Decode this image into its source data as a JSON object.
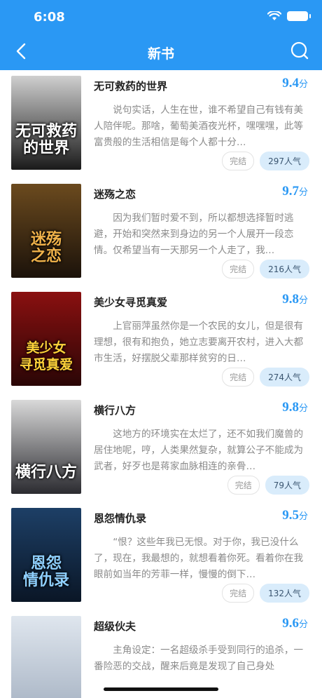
{
  "status_bar": {
    "time": "6:08"
  },
  "nav": {
    "title": "新书"
  },
  "colors": {
    "accent": "#2a98f4",
    "popularity_bg": "#d9ecfb"
  },
  "books": [
    {
      "title": "无可救药的世界",
      "cover_text": "无可救药\n的世界",
      "score": "9.4",
      "score_unit": "分",
      "description": "说句实话，人生在世，谁不希望自己有钱有美人陪伴呢。那啥，葡萄美酒夜光杯，嘿嘿嘿，此等富贵般的生活相信是每个人都十分…",
      "status": "完结",
      "popularity": "297人气",
      "cover_colors": [
        "#cfcfcf",
        "#1a1a1a"
      ]
    },
    {
      "title": "迷殇之恋",
      "cover_text": "迷殇\n之恋",
      "score": "9.7",
      "score_unit": "分",
      "description": "因为我们暂时爱不到，所以都想选择暂时逃避，开始和突然来到身边的另一个人展开一段恋情。仅希望当有一天那另一个人走了，我…",
      "status": "完结",
      "popularity": "216人气",
      "cover_colors": [
        "#6b4a1e",
        "#1b120a"
      ]
    },
    {
      "title": "美少女寻觅真爱",
      "cover_text": "美少女\n寻觅真爱",
      "score": "9.8",
      "score_unit": "分",
      "description": "上官丽萍虽然你是一个农民的女儿，但是很有理想，很有和抱负，她立志要离开农村，进入大都市生活，好摆脱父辈那样贫穷的日…",
      "status": "完结",
      "popularity": "274人气",
      "cover_colors": [
        "#8a1010",
        "#2a0606"
      ]
    },
    {
      "title": "横行八方",
      "cover_text": "横行八方",
      "score": "9.8",
      "score_unit": "分",
      "description": "这地方的环境实在太烂了，还不如我们魔兽的居住地呢，哼，人类果然复杂，就算公子不能成为武者，好歹也是蒋家血脉相连的亲骨…",
      "status": "完结",
      "popularity": "79人气",
      "cover_colors": [
        "#d9d9d9",
        "#2b2b30"
      ]
    },
    {
      "title": "恩怨情仇录",
      "cover_text": "恩怨\n情仇录",
      "score": "9.5",
      "score_unit": "分",
      "description": "“恨？这些年我已无恨。对于你，我已没什么了，现在，我最想的，就想看着你死。看着你在我眼前如当年的芳菲一样，慢慢的倒下…",
      "status": "完结",
      "popularity": "132人气",
      "cover_colors": [
        "#1d3f66",
        "#0a1626"
      ]
    },
    {
      "title": "超级伙夫",
      "cover_text": "",
      "score": "9.6",
      "score_unit": "分",
      "description": "主角设定：一名超级杀手受到同行的追杀，一番险恶的交战，醒来后竟是发现了自己身处",
      "status": "",
      "popularity": "",
      "cover_colors": [
        "#dfe6ee",
        "#a8b4c4"
      ]
    }
  ]
}
